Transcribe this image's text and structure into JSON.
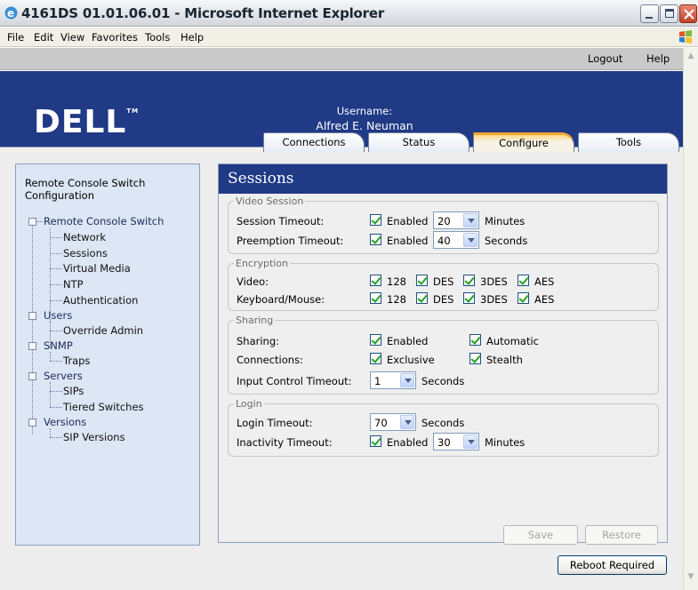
{
  "window": {
    "title": "4161DS 01.01.06.01 - Microsoft Internet Explorer"
  },
  "menu": [
    "File",
    "Edit",
    "View",
    "Favorites",
    "Tools",
    "Help"
  ],
  "topbar": {
    "logout": "Logout",
    "help": "Help"
  },
  "header": {
    "logo": "DELL",
    "username_label": "Username:",
    "username": "Alfred E. Neuman"
  },
  "tabs": [
    {
      "label": "Connections",
      "active": false
    },
    {
      "label": "Status",
      "active": false
    },
    {
      "label": "Configure",
      "active": true
    },
    {
      "label": "Tools",
      "active": false
    }
  ],
  "nav": {
    "title": "Remote Console Switch Configuration",
    "tree": [
      {
        "label": "Remote Console Switch",
        "children": [
          "Network",
          "Sessions",
          "Virtual Media",
          "NTP",
          "Authentication"
        ]
      },
      {
        "label": "Users",
        "children": [
          "Override Admin"
        ]
      },
      {
        "label": "SNMP",
        "children": [
          "Traps"
        ]
      },
      {
        "label": "Servers",
        "children": [
          "SIPs",
          "Tiered Switches"
        ]
      },
      {
        "label": "Versions",
        "children": [
          "SIP Versions"
        ]
      }
    ]
  },
  "sessions": {
    "title": "Sessions",
    "video_session": {
      "legend": "Video Session",
      "session_timeout": {
        "label": "Session Timeout:",
        "enabled_label": "Enabled",
        "enabled": true,
        "value": "20",
        "unit": "Minutes"
      },
      "preemption_timeout": {
        "label": "Preemption Timeout:",
        "enabled_label": "Enabled",
        "enabled": true,
        "value": "40",
        "unit": "Seconds"
      }
    },
    "encryption": {
      "legend": "Encryption",
      "options": [
        "128",
        "DES",
        "3DES",
        "AES"
      ],
      "video": {
        "label": "Video:",
        "checked": [
          true,
          true,
          true,
          true
        ]
      },
      "keyboard_mouse": {
        "label": "Keyboard/Mouse:",
        "checked": [
          true,
          true,
          true,
          true
        ]
      }
    },
    "sharing": {
      "legend": "Sharing",
      "sharing_label": "Sharing:",
      "enabled_label": "Enabled",
      "automatic_label": "Automatic",
      "connections_label": "Connections:",
      "exclusive_label": "Exclusive",
      "stealth_label": "Stealth",
      "input_control_label": "Input Control Timeout:",
      "input_control_value": "1",
      "input_control_unit": "Seconds"
    },
    "login": {
      "legend": "Login",
      "login_timeout_label": "Login Timeout:",
      "login_timeout_value": "70",
      "login_timeout_unit": "Seconds",
      "inactivity_label": "Inactivity Timeout:",
      "inactivity_enabled_label": "Enabled",
      "inactivity_value": "30",
      "inactivity_unit": "Minutes"
    },
    "buttons": {
      "save": "Save",
      "restore": "Restore"
    }
  },
  "reboot_button": "Reboot Required"
}
